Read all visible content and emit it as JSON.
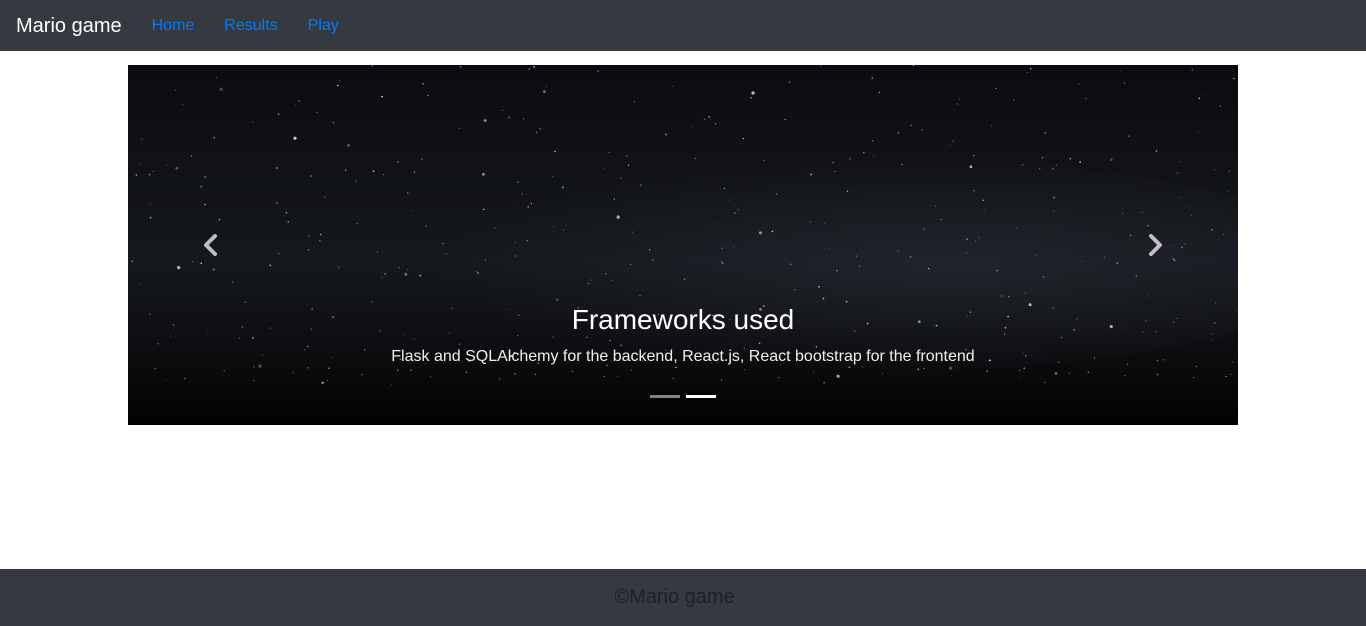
{
  "navbar": {
    "brand": "Mario game",
    "links": [
      {
        "label": "Home"
      },
      {
        "label": "Results"
      },
      {
        "label": "Play"
      }
    ],
    "link_color": "#007bff",
    "background": "#343a40"
  },
  "carousel": {
    "prev_icon": "chevron-left-icon",
    "next_icon": "chevron-right-icon",
    "active_slide": {
      "title": "Frameworks used",
      "text": "Flask and SQLAlchemy for the backend, React.js, React bootstrap for the frontend"
    },
    "indicator_count": 2,
    "active_index": 1
  },
  "footer": {
    "text": "©Mario game"
  }
}
